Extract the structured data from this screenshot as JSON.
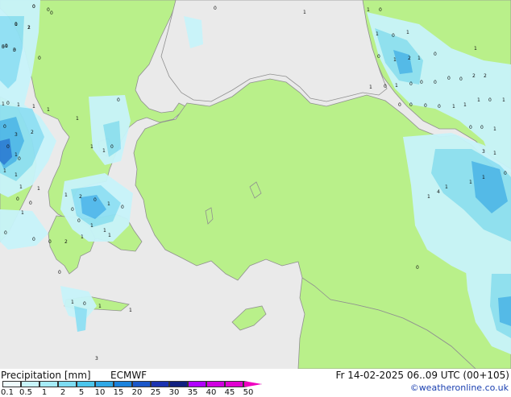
{
  "title": "Precipitation [mm]",
  "model": "ECMWF",
  "timestamp": "Fr 14-02-2025 06..09 UTC (00+105)",
  "credit": "©weatheronline.co.uk",
  "colors": {
    "land": "#b9f08a",
    "sea": "#eaeaea",
    "coast": "#909090",
    "precip_light": "#c8f4fa",
    "precip_mid": "#8ee0f4",
    "precip_strong": "#4fb8ec",
    "precip_heavy": "#2a7ed8"
  },
  "legend": {
    "swatch_colors": [
      "#eefcfd",
      "#c8f4fa",
      "#a6ecf8",
      "#7ddcf2",
      "#4cc6ec",
      "#30a8e6",
      "#1a82dc",
      "#1b57c8",
      "#1b33b0",
      "#102080",
      "#b000ff",
      "#d000e0",
      "#e000d0",
      "#f000c0"
    ],
    "tick_labels": [
      "0.1",
      "0.5",
      "1",
      "2",
      "5",
      "10",
      "15",
      "20",
      "25",
      "30",
      "35",
      "40",
      "45",
      "50"
    ]
  },
  "map_labels": [
    "1",
    "2",
    "1",
    "5",
    "3",
    "0",
    "0",
    "0",
    "0",
    "1",
    "0",
    "1",
    "1",
    "1",
    "0",
    "2",
    "3",
    "0",
    "1",
    "0",
    "1",
    "1",
    "1",
    "1",
    "0",
    "0",
    "1",
    "2",
    "0",
    "1",
    "0",
    "0",
    "0",
    "1",
    "1",
    "1",
    "1",
    "2",
    "0",
    "0",
    "0",
    "1",
    "0",
    "1",
    "0",
    "1",
    "1",
    "3",
    "1",
    "1",
    "0",
    "0",
    "1",
    "0",
    "1",
    "1",
    "0",
    "1",
    "0",
    "1",
    "0",
    "1",
    "2",
    "1",
    "0",
    "1",
    "2",
    "0",
    "0",
    "2",
    "1",
    "0",
    "1",
    "0",
    "0",
    "0",
    "0",
    "0",
    "0",
    "0",
    "1",
    "1",
    "1",
    "0",
    "1",
    "0",
    "0",
    "1",
    "3",
    "1",
    "0",
    "1",
    "1",
    "1",
    "4",
    "1",
    "0",
    "0",
    "1",
    "0",
    "0",
    "0",
    "0"
  ]
}
